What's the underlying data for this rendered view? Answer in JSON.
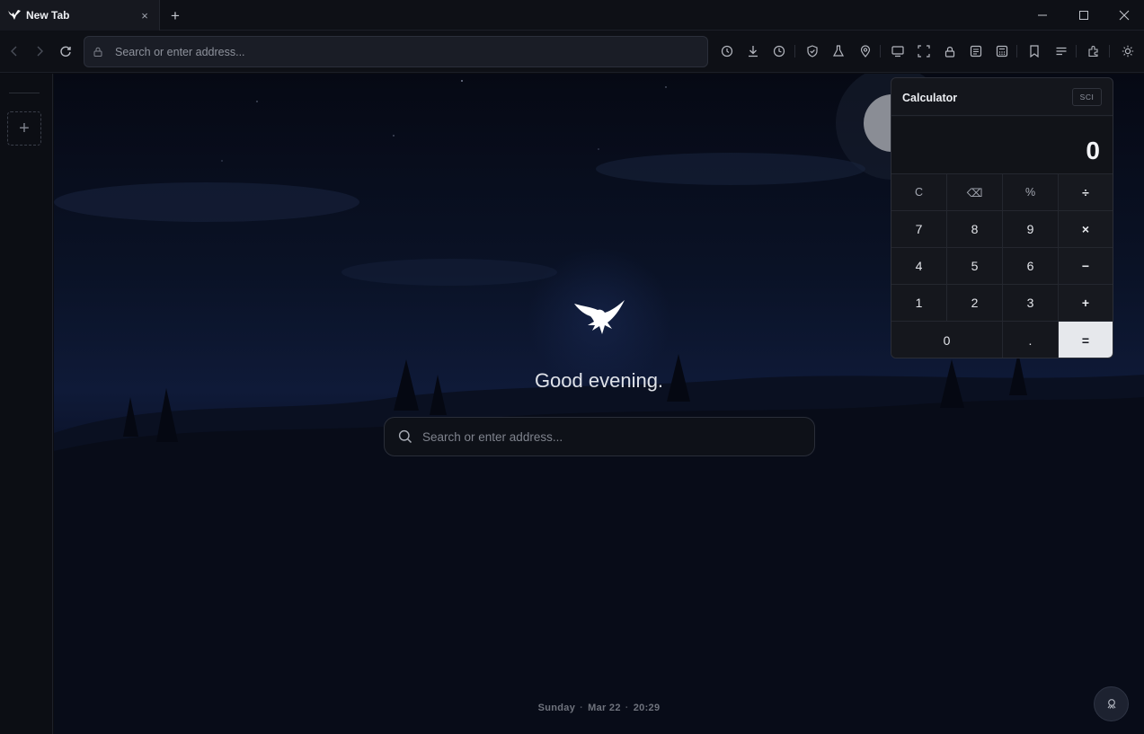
{
  "tab": {
    "title": "New Tab",
    "close_glyph": "×",
    "icon": "eagle-logo-icon"
  },
  "tabstrip": {
    "new_tab_glyph": "+"
  },
  "window": {
    "minimize": "minimize-icon",
    "maximize": "maximize-icon",
    "close": "close-icon"
  },
  "address": {
    "placeholder": "Search or enter address..."
  },
  "toolbar_icons": [
    "history-icon",
    "download-icon",
    "clock-icon",
    "shield-icon",
    "flask-icon",
    "location-pin-icon",
    "cast-icon",
    "screenshot-icon",
    "lock-icon",
    "reader-icon",
    "calculator-icon",
    "bookmark-icon",
    "list-icon",
    "extensions-icon",
    "brightness-icon"
  ],
  "sidebar": {
    "add_glyph": "+"
  },
  "main": {
    "greeting": "Good evening.",
    "search_placeholder": "Search or enter address...",
    "day": "Sunday",
    "date": "Mar 22",
    "time": "20:29",
    "separator": "·"
  },
  "calculator": {
    "title": "Calculator",
    "mode": "SCI",
    "display": "0",
    "keys": {
      "clear": "C",
      "backspace": "⌫",
      "percent": "%",
      "divide": "÷",
      "seven": "7",
      "eight": "8",
      "nine": "9",
      "multiply": "×",
      "four": "4",
      "five": "5",
      "six": "6",
      "minus": "−",
      "one": "1",
      "two": "2",
      "three": "3",
      "plus": "+",
      "zero": "0",
      "decimal": ".",
      "equals": "="
    }
  },
  "colors": {
    "accent": "#e6e8ec",
    "background": "#0b0d13",
    "sky": "#0f1a38"
  }
}
